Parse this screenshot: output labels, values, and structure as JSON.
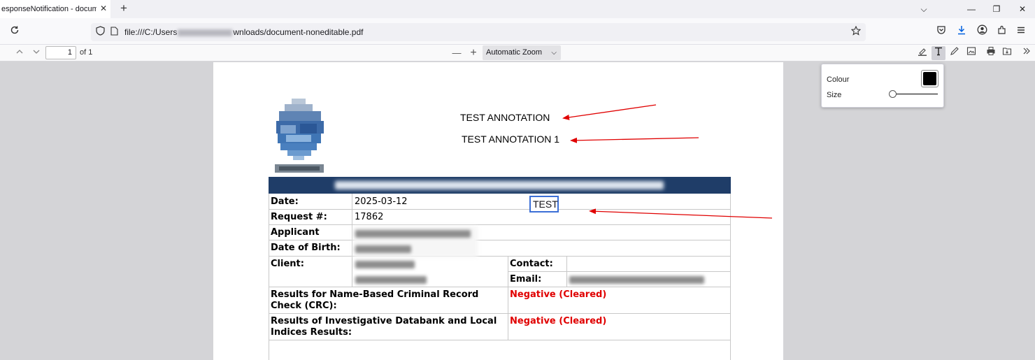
{
  "browser": {
    "tab_title": "esponseNotification - document",
    "tab_close": "✕",
    "new_tab": "+",
    "window_controls": [
      "⌵",
      "—",
      "❐",
      "✕"
    ],
    "url_prefix": "file:///C:/Users",
    "url_suffix": "wnloads/document-noneditable.pdf"
  },
  "pdf_toolbar": {
    "page_number": "1",
    "page_of": "of 1",
    "zoom_out": "—",
    "zoom_in": "+",
    "zoom_label": "Automatic Zoom"
  },
  "annotations": {
    "line1": "TEST ANNOTATION",
    "line2": "TEST ANNOTATION 1",
    "textbox": "TEST"
  },
  "form": {
    "date_label": "Date:",
    "date_value": "2025-03-12",
    "request_label": "Request #:",
    "request_value": "17862",
    "applicant_label": "Applicant",
    "dob_label": "Date of Birth:",
    "client_label": "Client:",
    "contact_label": "Contact:",
    "email_label": "Email:",
    "crc_label_1": "Results for Name-Based Criminal Record",
    "crc_label_2": "Check (CRC):",
    "crc_value": "Negative (Cleared)",
    "idb_label_1": "Results of Investigative Databank and Local",
    "idb_label_2": "Indices Results:",
    "idb_value": "Negative (Cleared)"
  },
  "text_editor_popup": {
    "colour_label": "Colour",
    "size_label": "Size",
    "colour_value": "#000000",
    "size_fraction": 0.05
  },
  "colors": {
    "banner": "#1f3d68",
    "negative": "#e00000",
    "arrow": "#e00000",
    "textbox_border": "#3b6fd6"
  }
}
